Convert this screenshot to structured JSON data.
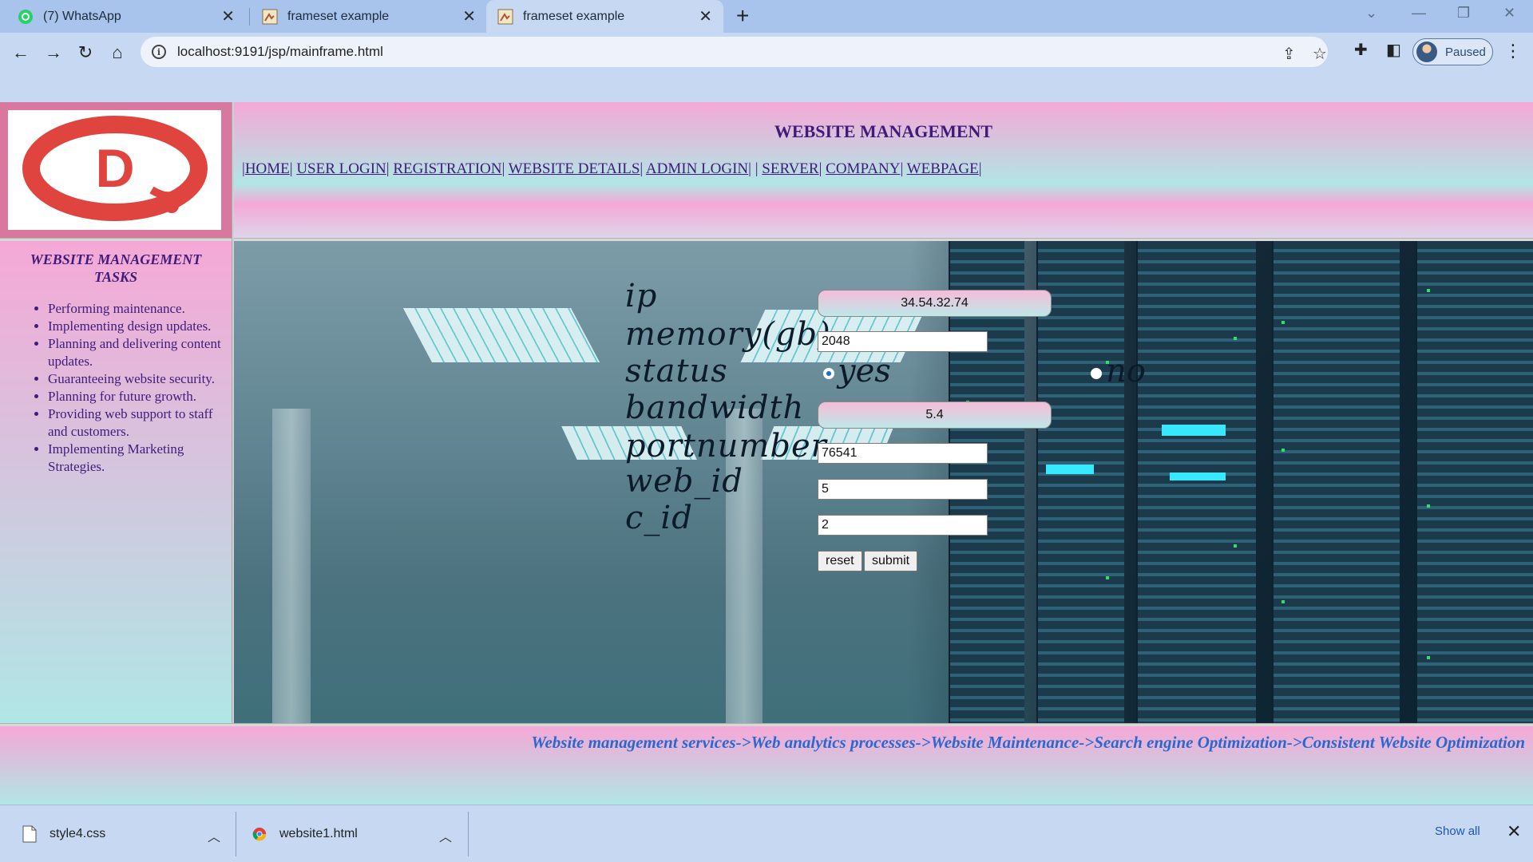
{
  "browser": {
    "tabs": [
      {
        "title": "(7) WhatsApp",
        "icon": "whatsapp-icon",
        "active": false
      },
      {
        "title": "frameset example",
        "icon": "page-icon",
        "active": false
      },
      {
        "title": "frameset example",
        "icon": "page-icon",
        "active": true
      }
    ],
    "url": "localhost:9191/jsp/mainframe.html",
    "profile_label": "Paused"
  },
  "header": {
    "title": "WEBSITE MANAGEMENT",
    "nav": [
      "HOME",
      "USER LOGIN",
      "REGISTRATION",
      "WEBSITE DETAILS",
      "ADMIN LOGIN",
      "SERVER",
      "COMPANY",
      "WEBPAGE"
    ]
  },
  "logo": {
    "letter": "D",
    "color": "#e0443e"
  },
  "sidebar": {
    "title": "WEBSITE MANAGEMENT TASKS",
    "items": [
      "Performing maintenance.",
      "Implementing design updates.",
      "Planning and delivering content updates.",
      "Guaranteeing website security.",
      "Planning for future growth.",
      "Providing web support to staff and customers.",
      "Implementing Marketing Strategies."
    ]
  },
  "form": {
    "labels": {
      "ip": "ip",
      "memory": "memory(gb)",
      "status": "status",
      "bandwidth": "bandwidth",
      "portnumber": "portnumber",
      "web_id": "web_id",
      "c_id": "c_id"
    },
    "values": {
      "ip": "34.54.32.74",
      "memory": "2048",
      "bandwidth": "5.4",
      "portnumber": "76541",
      "web_id": "5",
      "c_id": "2"
    },
    "status_options": [
      "yes",
      "no"
    ],
    "status_selected": "yes",
    "reset_label": "reset",
    "submit_label": "submit"
  },
  "footer": {
    "marquee": "Website management services->Web analytics processes->Website Maintenance->Search engine Optimization->Consistent Website Optimization"
  },
  "downloads": {
    "items": [
      "style4.css",
      "website1.html"
    ],
    "show_all": "Show all"
  },
  "colors": {
    "accent_text": "#3f1b7a",
    "footer_text": "#2a68d0",
    "gradient_top": "#f5a8d6",
    "gradient_bottom": "#b0e6e6"
  }
}
